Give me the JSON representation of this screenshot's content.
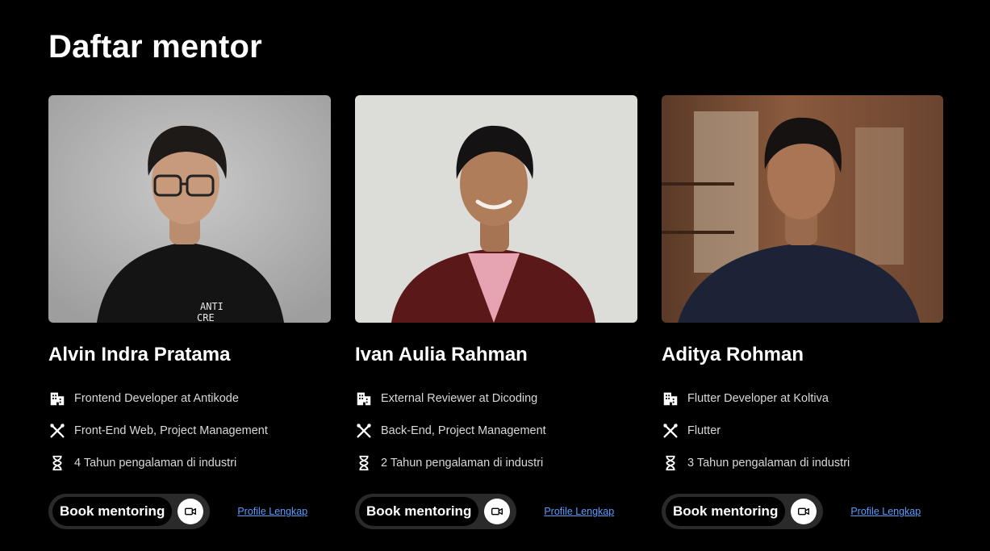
{
  "page": {
    "title": "Daftar mentor"
  },
  "colors": {
    "background": "#000000",
    "text": "#ffffff",
    "muted_text": "#d9d9d9",
    "link": "#5c9cff",
    "button_outer": "#2a2a2a"
  },
  "mentors": [
    {
      "name": "Alvin Indra Pratama",
      "photo_icon": "mentor-photo",
      "role": "Frontend Developer at Antikode",
      "skills": "Front-End Web, Project Management",
      "experience": "4 Tahun pengalaman di industri",
      "book_label": "Book mentoring",
      "profile_label": "Profile Lengkap"
    },
    {
      "name": "Ivan Aulia Rahman",
      "photo_icon": "mentor-photo",
      "role": "External Reviewer at Dicoding",
      "skills": "Back-End, Project Management",
      "experience": "2 Tahun pengalaman di industri",
      "book_label": "Book mentoring",
      "profile_label": "Profile Lengkap"
    },
    {
      "name": "Aditya Rohman",
      "photo_icon": "mentor-photo",
      "role": "Flutter Developer at Koltiva",
      "skills": "Flutter",
      "experience": "3 Tahun pengalaman di industri",
      "book_label": "Book mentoring",
      "profile_label": "Profile Lengkap"
    }
  ],
  "icons": {
    "role": "building-icon",
    "skills": "tools-icon",
    "experience": "hourglass-icon",
    "book": "video-camera-icon"
  }
}
